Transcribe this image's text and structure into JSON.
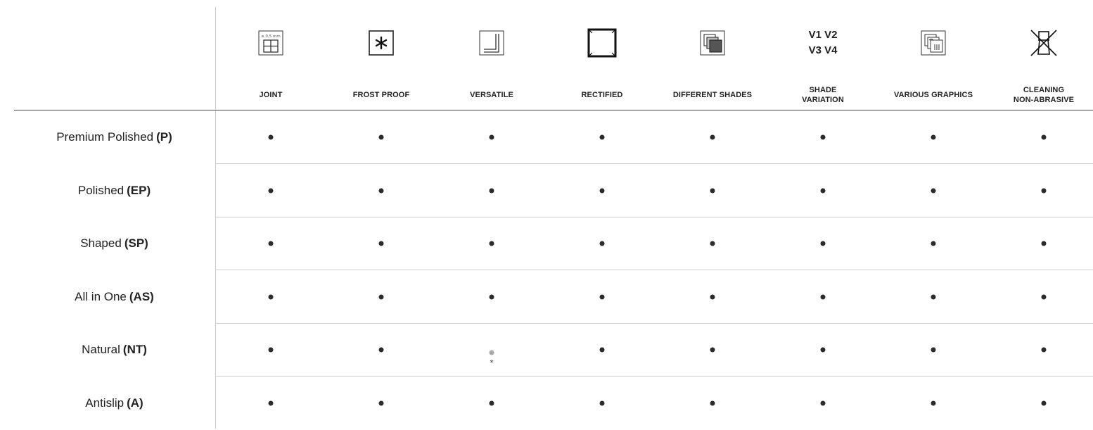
{
  "columns": [
    {
      "key": "joint",
      "label": "JOINT",
      "icon": "joint-icon",
      "icon_text": "≥ 0,5 mm"
    },
    {
      "key": "frost_proof",
      "label": "FROST PROOF",
      "icon": "snowflake-icon"
    },
    {
      "key": "versatile",
      "label": "VERSATILE",
      "icon": "corner-icon"
    },
    {
      "key": "rectified",
      "label": "RECTIFIED",
      "icon": "square-frame-icon"
    },
    {
      "key": "different_shades",
      "label": "DIFFERENT SHADES",
      "icon": "layered-squares-icon"
    },
    {
      "key": "shade_variation",
      "label": "SHADE\nVARIATION",
      "icon_text": "V1  V2\nV3  V4"
    },
    {
      "key": "various_graphics",
      "label": "VARIOUS GRAPHICS",
      "icon": "stacked-graphics-icon"
    },
    {
      "key": "cleaning",
      "label": "CLEANING\nNON-ABRASIVE",
      "icon": "no-abrasive-cleaning-icon"
    }
  ],
  "rows": [
    {
      "name": "Premium Polished",
      "code": "(P)",
      "values": [
        "full",
        "full",
        "full",
        "full",
        "full",
        "full",
        "full",
        "full"
      ]
    },
    {
      "name": "Polished",
      "code": "(EP)",
      "values": [
        "full",
        "full",
        "full",
        "full",
        "full",
        "full",
        "full",
        "full"
      ]
    },
    {
      "name": "Shaped",
      "code": "(SP)",
      "values": [
        "full",
        "full",
        "full",
        "full",
        "full",
        "full",
        "full",
        "full"
      ]
    },
    {
      "name": "All in One",
      "code": "(AS)",
      "values": [
        "full",
        "full",
        "full",
        "full",
        "full",
        "full",
        "full",
        "full"
      ]
    },
    {
      "name": "Natural",
      "code": "(NT)",
      "values": [
        "full",
        "full",
        "partial",
        "full",
        "full",
        "full",
        "full",
        "full"
      ]
    },
    {
      "name": "Antislip",
      "code": "(A)",
      "values": [
        "full",
        "full",
        "full",
        "full",
        "full",
        "full",
        "full",
        "full"
      ]
    }
  ],
  "partial_mark": "*",
  "colors": {
    "dot": "#2b2b2b",
    "partial_dot": "#a8a8a8",
    "rule": "#cfcfcf"
  }
}
